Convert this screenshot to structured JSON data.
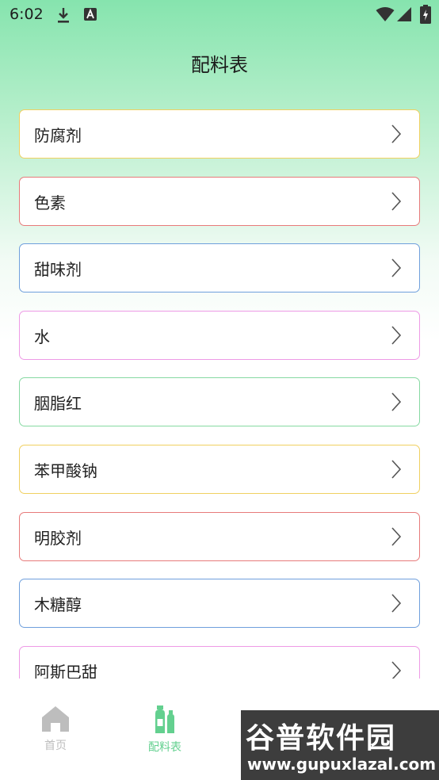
{
  "status_bar": {
    "time": "6:02"
  },
  "header": {
    "title": "配料表"
  },
  "list": {
    "items": [
      {
        "label": "防腐剂",
        "color": "#f0d060"
      },
      {
        "label": "色素",
        "color": "#e77a7a"
      },
      {
        "label": "甜味剂",
        "color": "#6f9fdc"
      },
      {
        "label": "水",
        "color": "#ee9ae6"
      },
      {
        "label": "胭脂红",
        "color": "#86d9a2"
      },
      {
        "label": "苯甲酸钠",
        "color": "#f0d060"
      },
      {
        "label": "明胶剂",
        "color": "#e77a7a"
      },
      {
        "label": "木糖醇",
        "color": "#6f9fdc"
      },
      {
        "label": "阿斯巴甜",
        "color": "#ee9ae6"
      }
    ]
  },
  "tabbar": {
    "accent": "#63d08f",
    "inactive_color": "#bdbdbd",
    "tabs": [
      {
        "label": "首页",
        "icon": "home-icon",
        "active": false
      },
      {
        "label": "配料表",
        "icon": "bottles-icon",
        "active": true
      }
    ]
  },
  "watermark": {
    "text": "谷普软件园",
    "url": "www.gupuxlazal.com"
  }
}
